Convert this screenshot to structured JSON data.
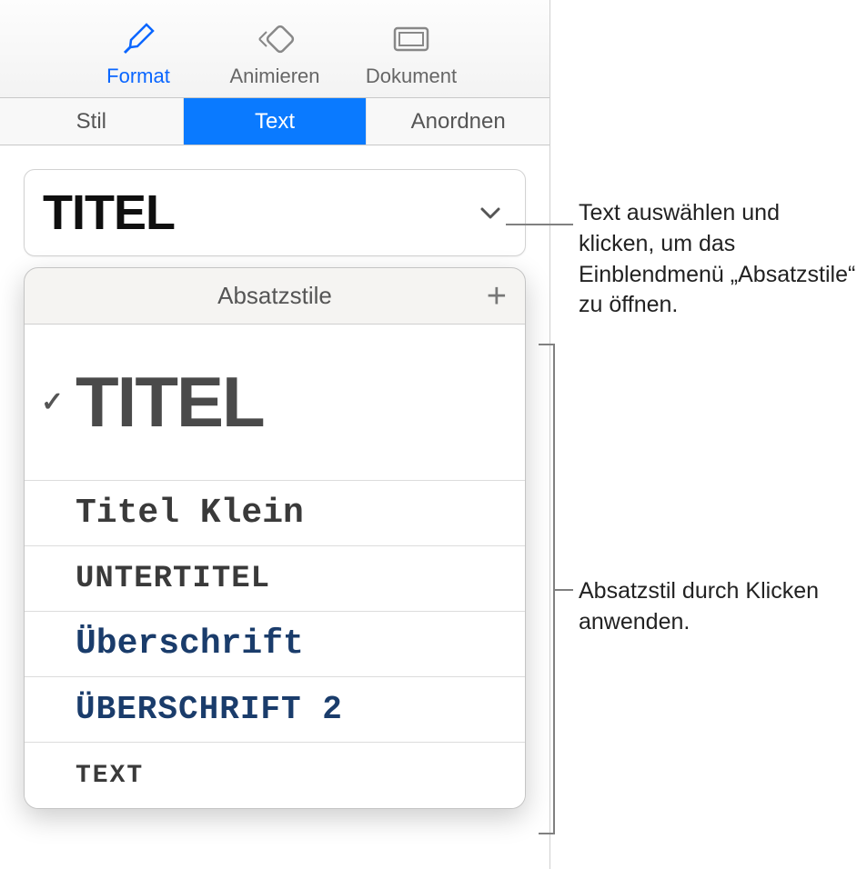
{
  "toolbar": {
    "format": "Format",
    "animate": "Animieren",
    "document": "Dokument"
  },
  "tabs": {
    "style": "Stil",
    "text": "Text",
    "arrange": "Anordnen"
  },
  "currentStyle": "TITEL",
  "popover": {
    "title": "Absatzstile",
    "items": {
      "titel": "TITEL",
      "titelklein": "Titel Klein",
      "untertitel": "UNTERTITEL",
      "heading": "Überschrift",
      "heading2": "ÜBERSCHRIFT 2",
      "text": "TEXT"
    }
  },
  "callouts": {
    "dropdown": "Text auswählen und klicken, um das Einblendmenü „Absatzstile“ zu öffnen.",
    "list": "Absatzstil durch Klicken anwenden."
  }
}
